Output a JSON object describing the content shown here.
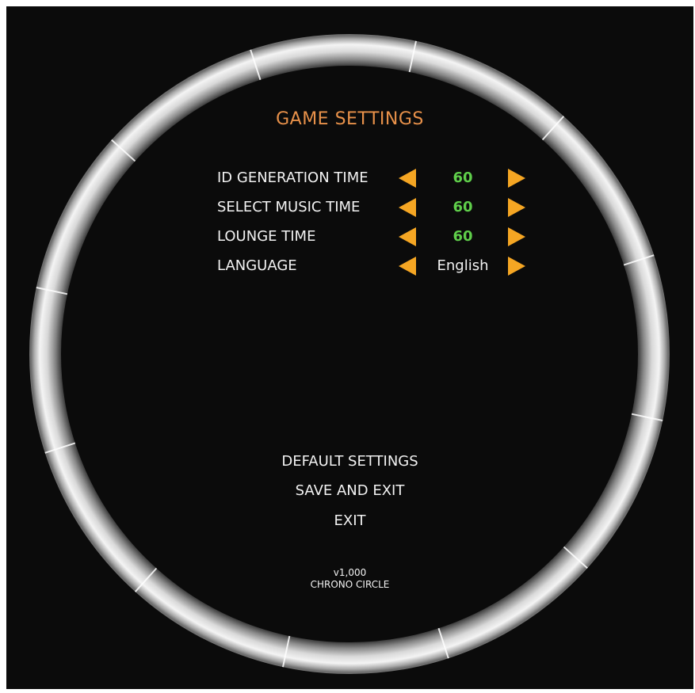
{
  "colors": {
    "title": "#e8914a",
    "value_numeric": "#5fce4a",
    "value_text": "#f2f2f2",
    "arrow": "#f5a623",
    "background": "#0b0b0b"
  },
  "title": "GAME SETTINGS",
  "settings": [
    {
      "label": "ID GENERATION TIME",
      "value": "60",
      "value_kind": "numeric",
      "left_icon": "arrow-left-icon",
      "right_icon": "arrow-right-icon"
    },
    {
      "label": "SELECT MUSIC TIME",
      "value": "60",
      "value_kind": "numeric",
      "left_icon": "arrow-left-icon",
      "right_icon": "arrow-right-icon"
    },
    {
      "label": "LOUNGE TIME",
      "value": "60",
      "value_kind": "numeric",
      "left_icon": "arrow-left-icon",
      "right_icon": "arrow-right-icon"
    },
    {
      "label": "LANGUAGE",
      "value": "English",
      "value_kind": "text",
      "left_icon": "arrow-left-icon",
      "right_icon": "arrow-right-icon"
    }
  ],
  "menu": {
    "default_settings": "DEFAULT SETTINGS",
    "save_and_exit": "SAVE AND EXIT",
    "exit": "EXIT"
  },
  "footer": {
    "version": "v1,000",
    "game_name": "CHRONO CIRCLE"
  }
}
